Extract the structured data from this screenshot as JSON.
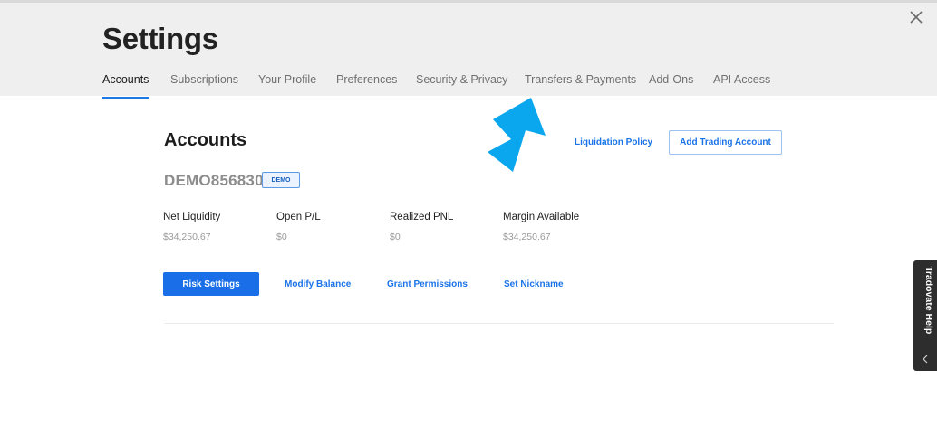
{
  "header": {
    "title": "Settings",
    "tabs": [
      {
        "label": "Accounts",
        "active": true
      },
      {
        "label": "Subscriptions",
        "active": false
      },
      {
        "label": "Your Profile",
        "active": false
      },
      {
        "label": "Preferences",
        "active": false
      },
      {
        "label": "Security & Privacy",
        "active": false
      },
      {
        "label": "Transfers & Payments",
        "active": false
      },
      {
        "label": "Add-Ons",
        "active": false
      },
      {
        "label": "API Access",
        "active": false
      }
    ],
    "close_icon": "close-icon"
  },
  "main": {
    "section_title": "Accounts",
    "liquidation_policy_label": "Liquidation Policy",
    "add_trading_account_label": "Add Trading Account",
    "account_id": "DEMO856830",
    "account_badge": "DEMO",
    "metrics": [
      {
        "label": "Net Liquidity",
        "value": "$34,250.67"
      },
      {
        "label": "Open P/L",
        "value": "$0"
      },
      {
        "label": "Realized PNL",
        "value": "$0"
      },
      {
        "label": "Margin Available",
        "value": "$34,250.67"
      }
    ],
    "actions": {
      "risk_settings": "Risk Settings",
      "modify_balance": "Modify Balance",
      "grant_permissions": "Grant Permissions",
      "set_nickname": "Set Nickname"
    }
  },
  "help_tab": {
    "label": "Tradovate Help",
    "icon": "chevron-left-icon"
  },
  "colors": {
    "accent": "#1a73e8",
    "header_bg": "#efefef",
    "arrow": "#0aa6ee",
    "help_bg": "#2d2d2d"
  }
}
